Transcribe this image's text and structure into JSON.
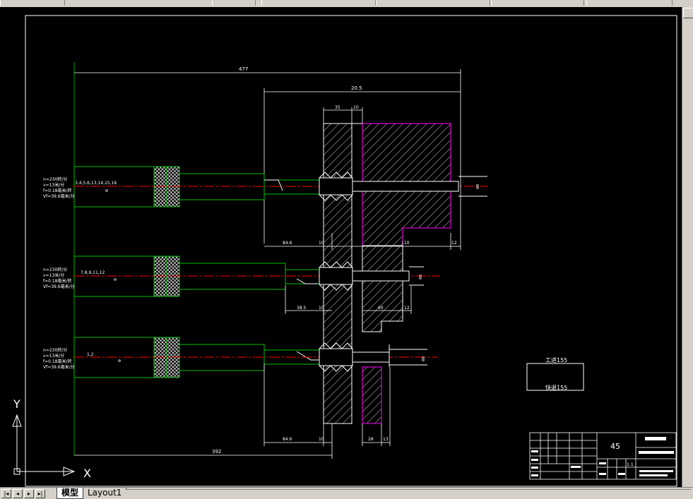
{
  "tabs": {
    "model": "模型",
    "layout1": "Layout1"
  },
  "ucs": {
    "x": "X",
    "y": "Y"
  },
  "dims": {
    "overall_top": "477",
    "top_span": "20.5",
    "d35": "35",
    "d10a": "10",
    "d84a": "84.6",
    "d10b": "10",
    "d110": "110",
    "d12a": "12",
    "d385": "38.5",
    "d10c": "10",
    "d60": "60",
    "d12b": "12",
    "d84b": "84.6",
    "d10d": "10",
    "d28": "28",
    "d13": "13",
    "overall_bottom": "392"
  },
  "spindles": [
    {
      "holes": "3,4,5,6,13,14,15,16",
      "params": [
        "n=230转/分",
        "v=13米/分",
        "f=0.18毫米/转",
        "Vf=39.6毫米/分"
      ]
    },
    {
      "holes": "7,8,9,11,12",
      "params": [
        "n=230转/分",
        "v=13米/分",
        "f=0.18毫米/转",
        "Vf=39.6毫米/分"
      ]
    },
    {
      "holes": "1,2",
      "params": [
        "n=230转/分",
        "v=13米/分",
        "f=0.18毫米/转",
        "Vf=39.6毫米/分"
      ]
    }
  ],
  "note_box": {
    "line1": "工进155",
    "line2": "快退155"
  },
  "title_block": {
    "material": "45",
    "scale": "1:1"
  }
}
